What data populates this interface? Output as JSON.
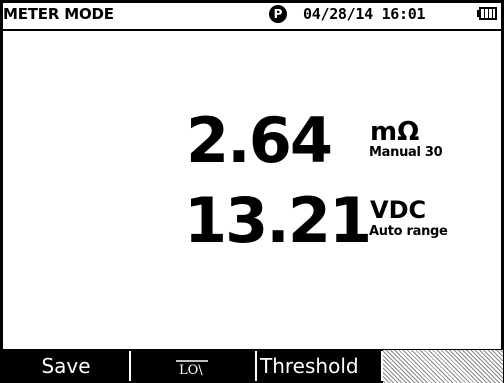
{
  "status_bar": {
    "mode_title": "METER MODE",
    "p_indicator": "P",
    "datetime": "04/28/14 16:01",
    "battery_icon": "battery-full-icon"
  },
  "primary_reading": {
    "value": "2.64",
    "unit": "mΩ",
    "range": "Manual 30"
  },
  "secondary_reading": {
    "value": "13.21",
    "unit": "VDC",
    "range": "Auto range"
  },
  "function_keys": {
    "f1_label": "Save",
    "f2_label": "LO\\",
    "f2_icon": "zero-offset-icon",
    "f3_label": "Threshold",
    "f4_label": ""
  },
  "colors": {
    "background": "#ffffff",
    "foreground": "#000000",
    "key_bar": "#000000",
    "key_text": "#ffffff"
  }
}
